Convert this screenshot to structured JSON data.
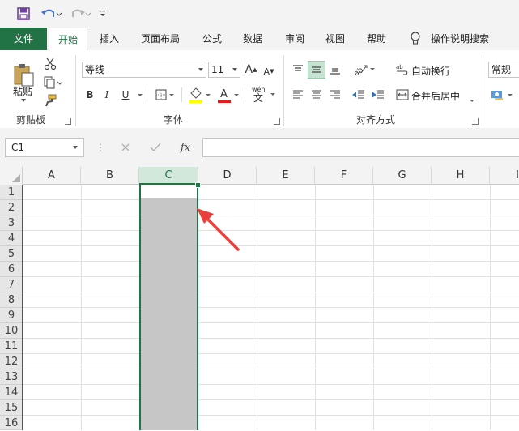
{
  "qat": {
    "save_icon": "save-icon",
    "undo_icon": "undo-icon",
    "redo_icon": "redo-icon",
    "customize_icon": "customize-qat-icon"
  },
  "tabs": [
    {
      "label": "文件"
    },
    {
      "label": "开始"
    },
    {
      "label": "插入"
    },
    {
      "label": "页面布局"
    },
    {
      "label": "公式"
    },
    {
      "label": "数据"
    },
    {
      "label": "审阅"
    },
    {
      "label": "视图"
    },
    {
      "label": "帮助"
    },
    {
      "label": "操作说明搜索"
    }
  ],
  "ribbon": {
    "paste_label": "粘贴",
    "clipboard_label": "剪贴板",
    "font_name": "等线",
    "font_size": "11",
    "bold": "B",
    "italic": "I",
    "underline": "U",
    "font_group_label": "字体",
    "wrap_text": "自动换行",
    "merge_center": "合并后居中",
    "alignment_group_label": "对齐方式",
    "number_format": "常规",
    "font_color_hex": "#e02020",
    "fill_color_hex": "#ffff00",
    "accent_hex": "#217346"
  },
  "formula_bar": {
    "name_box": "C1",
    "fx": "fx",
    "formula": ""
  },
  "columns": [
    "A",
    "B",
    "C",
    "D",
    "E",
    "F",
    "G",
    "H",
    "I"
  ],
  "rows": [
    "1",
    "2",
    "3",
    "4",
    "5",
    "6",
    "7",
    "8",
    "9",
    "10",
    "11",
    "12",
    "13",
    "14",
    "15",
    "16"
  ],
  "selection": {
    "column": "C",
    "active_cell": "C1"
  }
}
